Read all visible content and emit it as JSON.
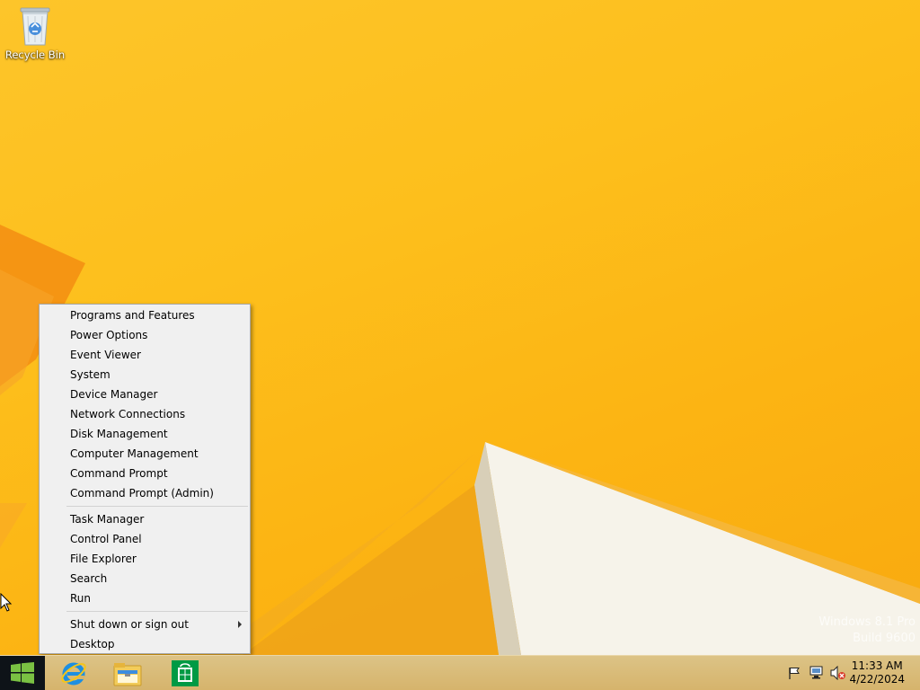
{
  "desktop": {
    "icons": [
      {
        "label": "Recycle Bin"
      }
    ],
    "watermark": {
      "line1": "Windows 8.1 Pro",
      "line2": "Build 9600"
    }
  },
  "context_menu": {
    "groups": [
      [
        "Programs and Features",
        "Power Options",
        "Event Viewer",
        "System",
        "Device Manager",
        "Network Connections",
        "Disk Management",
        "Computer Management",
        "Command Prompt",
        "Command Prompt (Admin)"
      ],
      [
        "Task Manager",
        "Control Panel",
        "File Explorer",
        "Search",
        "Run"
      ],
      [
        "Shut down or sign out",
        "Desktop"
      ]
    ],
    "submenu_item": "Shut down or sign out"
  },
  "taskbar": {
    "start_icon": "windows-logo-icon",
    "pinned_apps": [
      {
        "name": "internet-explorer-icon"
      },
      {
        "name": "file-explorer-icon"
      },
      {
        "name": "store-icon"
      }
    ],
    "tray": {
      "icons": [
        "action-center-flag-icon",
        "network-icon",
        "volume-muted-icon"
      ],
      "time": "11:33 AM",
      "date": "4/22/2024"
    }
  },
  "colors": {
    "wallpaper": "#fdbf1c",
    "menu_bg": "#f0f0f0",
    "taskbar": "#d9bb78",
    "start_button": "#0e1318"
  }
}
